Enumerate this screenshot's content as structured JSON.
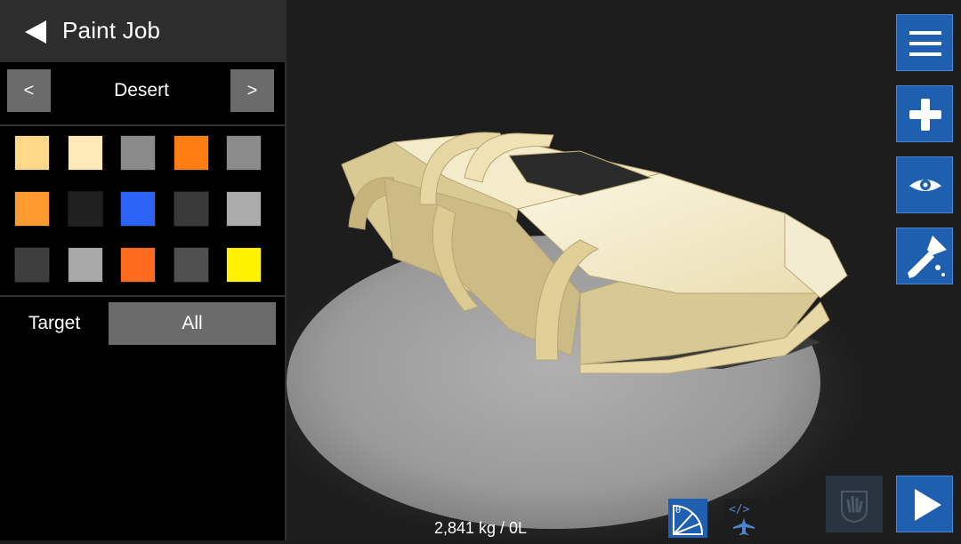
{
  "panel": {
    "title": "Paint Job",
    "preset": {
      "prev_label": "<",
      "name": "Desert",
      "next_label": ">"
    },
    "swatches": [
      "#ffd98a",
      "#ffe9b8",
      "#8a8a8a",
      "#ff7e14",
      "#8c8c8c",
      "#ff9a2e",
      "#202020",
      "#2a63f5",
      "#3a3a3a",
      "#ababab",
      "#3e3e3e",
      "#a8a8a8",
      "#ff6b1e",
      "#505050",
      "#fff200"
    ],
    "target": {
      "label": "Target",
      "value": "All"
    }
  },
  "toolbar": {
    "icons": [
      "menu-icon",
      "plus-icon",
      "eye-icon",
      "paint-brush-icon"
    ],
    "accent": "#1f5fb0"
  },
  "bottom_bar": {
    "stats": "2,841 kg / 0L",
    "tools": [
      "center-of-mass-icon",
      "airplane-code-icon",
      "hand-icon",
      "play-icon"
    ]
  },
  "colors": {
    "car_body": "#f1e8c2",
    "turntable": "#9a9a9a"
  }
}
